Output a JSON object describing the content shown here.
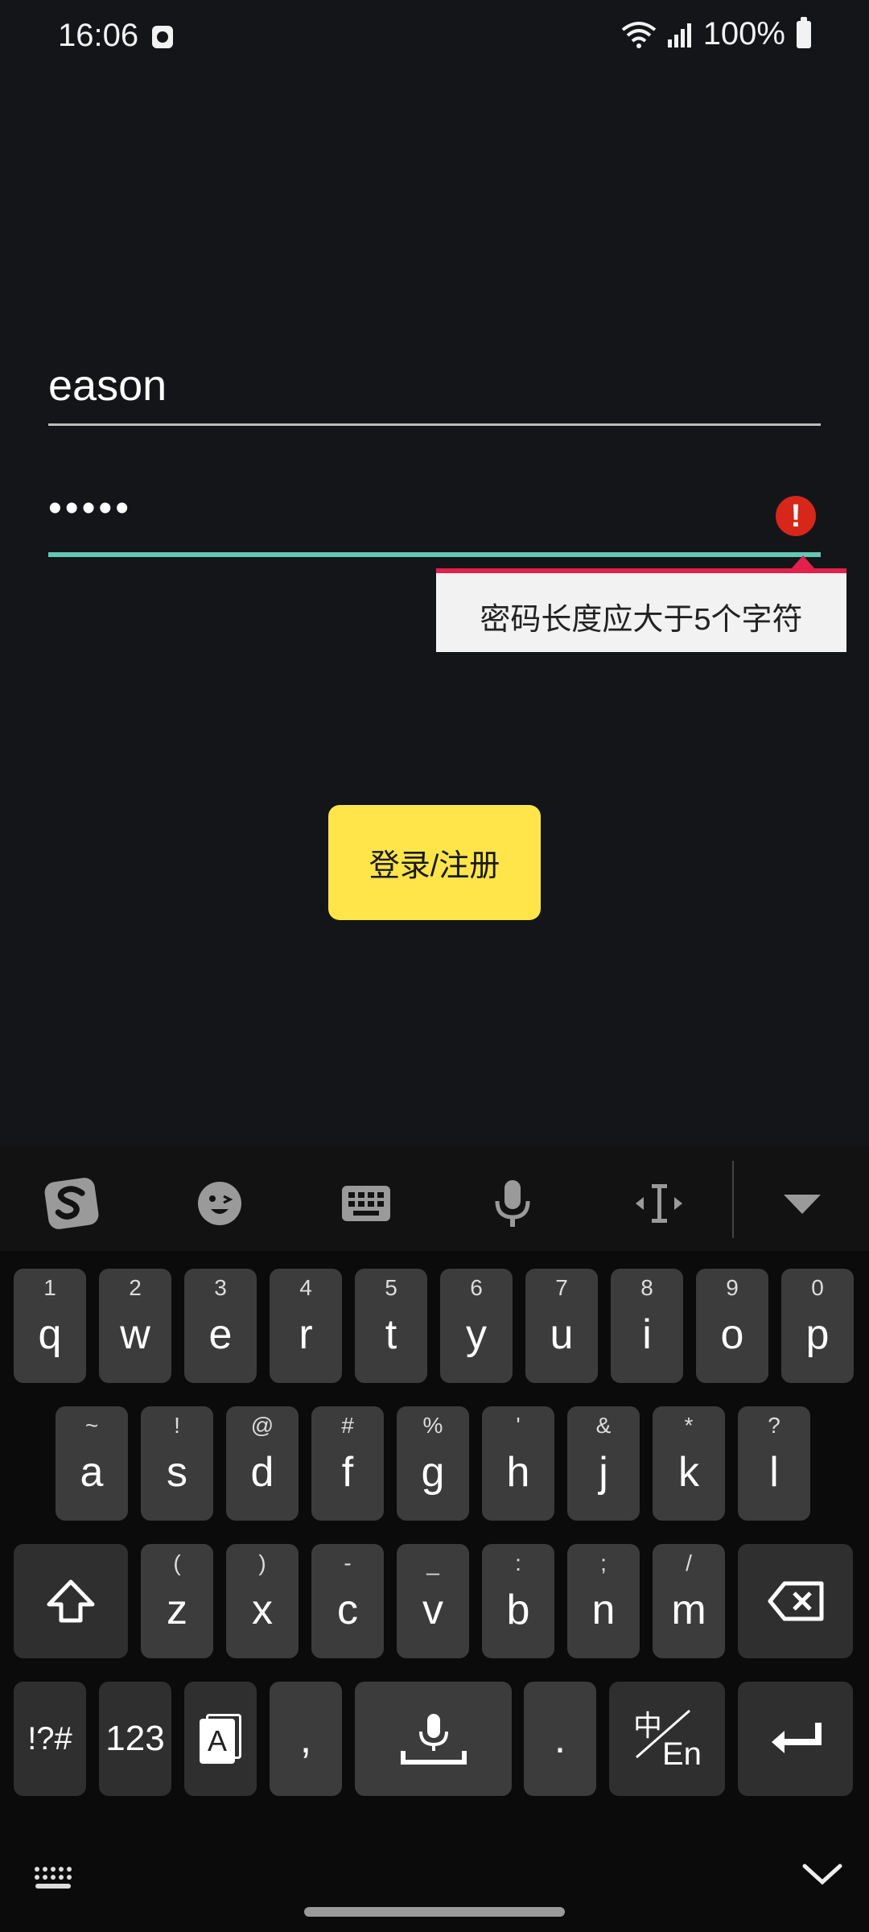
{
  "status_bar": {
    "time": "16:06",
    "battery": "100%"
  },
  "login": {
    "username_value": "eason",
    "password_value": "•••••",
    "error_tooltip": "密码长度应大于5个字符",
    "submit_label": "登录/注册"
  },
  "keyboard": {
    "toolbar_icons": [
      "sogou-logo-icon",
      "emoji-icon",
      "keyboard-icon",
      "microphone-icon",
      "cursor-move-icon",
      "hide-keyboard-icon"
    ],
    "row1": [
      {
        "k": "q",
        "h": "1"
      },
      {
        "k": "w",
        "h": "2"
      },
      {
        "k": "e",
        "h": "3"
      },
      {
        "k": "r",
        "h": "4"
      },
      {
        "k": "t",
        "h": "5"
      },
      {
        "k": "y",
        "h": "6"
      },
      {
        "k": "u",
        "h": "7"
      },
      {
        "k": "i",
        "h": "8"
      },
      {
        "k": "o",
        "h": "9"
      },
      {
        "k": "p",
        "h": "0"
      }
    ],
    "row2": [
      {
        "k": "a",
        "h": "~"
      },
      {
        "k": "s",
        "h": "!"
      },
      {
        "k": "d",
        "h": "@"
      },
      {
        "k": "f",
        "h": "#"
      },
      {
        "k": "g",
        "h": "%"
      },
      {
        "k": "h",
        "h": "'"
      },
      {
        "k": "j",
        "h": "&"
      },
      {
        "k": "k",
        "h": "*"
      },
      {
        "k": "l",
        "h": "?"
      }
    ],
    "row3": [
      {
        "k": "z",
        "h": "("
      },
      {
        "k": "x",
        "h": ")"
      },
      {
        "k": "c",
        "h": "-"
      },
      {
        "k": "v",
        "h": "_"
      },
      {
        "k": "b",
        "h": ":"
      },
      {
        "k": "n",
        "h": ";"
      },
      {
        "k": "m",
        "h": "/"
      }
    ],
    "symbols_label": "!?#",
    "numbers_label": "123",
    "clipboard_label": "A",
    "comma_label": ",",
    "period_label": ".",
    "lang_top": "中",
    "lang_bottom": "En"
  }
}
